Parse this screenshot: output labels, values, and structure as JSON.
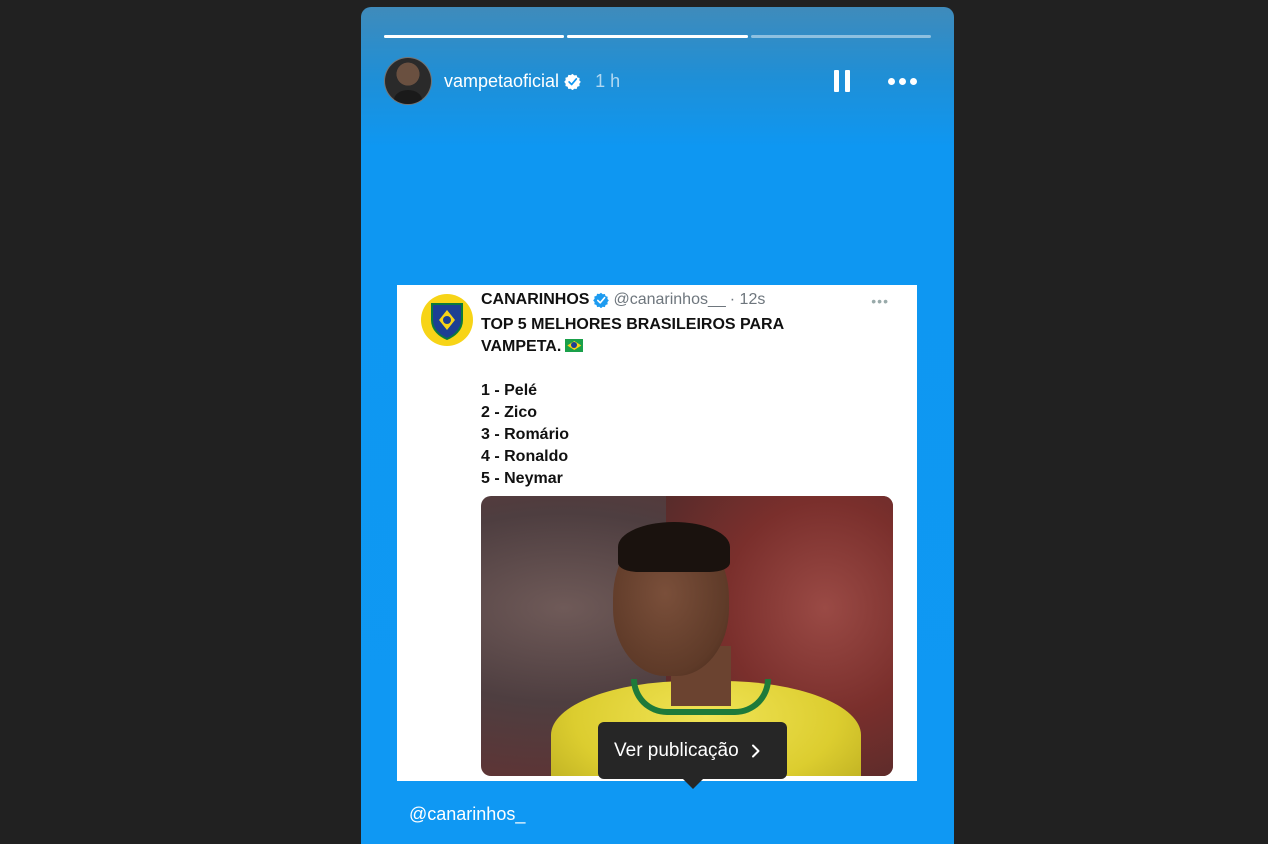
{
  "story": {
    "progress": [
      1,
      1,
      0
    ],
    "user": {
      "username": "vampetaoficial",
      "time": "1 h"
    },
    "mention": "@canarinhos_",
    "tooltip": {
      "label": "Ver publicação"
    }
  },
  "tweet": {
    "name": "CANARINHOS",
    "handle": "@canarinhos__",
    "time": "· 12s",
    "menu": "•••",
    "text_lines": [
      "TOP 5 MELHORES BRASILEIROS PARA",
      "VAMPETA.",
      "",
      "1 - Pelé",
      "2 - Zico",
      "3 - Romário",
      "4 - Ronaldo",
      "5 - Neymar"
    ]
  },
  "icons": {
    "verified": "verified-badge-icon",
    "pause": "pause-icon",
    "more": "more-icon",
    "flag": "brazil-flag-icon",
    "chevron": "chevron-right-icon"
  },
  "colors": {
    "story_bg": "#0f98f3",
    "page_bg": "#212121",
    "tooltip_bg": "#262626",
    "verified_blue": "#0095f6"
  }
}
